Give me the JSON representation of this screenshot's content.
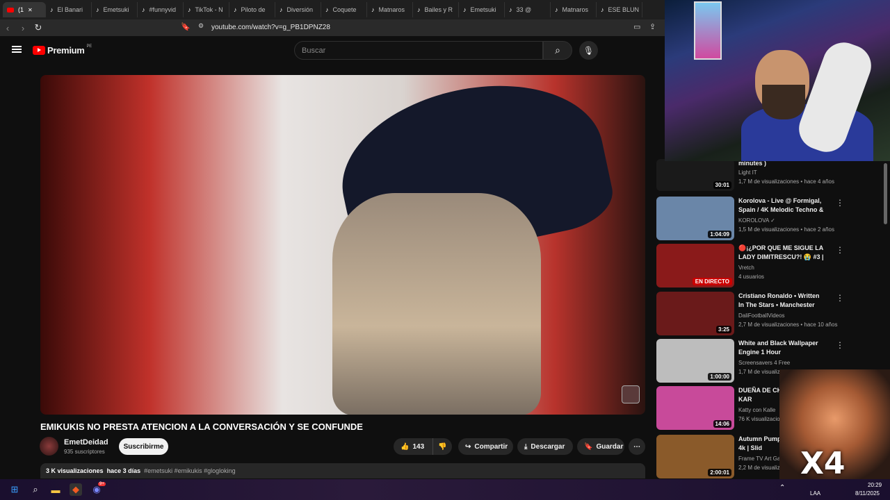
{
  "browser": {
    "tabs": [
      {
        "label": "(1",
        "active": true
      },
      {
        "label": "El Banari"
      },
      {
        "label": "Emetsuki"
      },
      {
        "label": "#funnyvid"
      },
      {
        "label": "TikTok - N"
      },
      {
        "label": "Piloto de"
      },
      {
        "label": "Diversión"
      },
      {
        "label": "Coquete"
      },
      {
        "label": "Matnaros"
      },
      {
        "label": "Bailes y R"
      },
      {
        "label": "Emetsuki"
      },
      {
        "label": "33 @"
      },
      {
        "label": "Matnaros"
      },
      {
        "label": "ESE BLUN"
      }
    ],
    "url": "youtube.com/watch?v=g_PB1DPNZ28"
  },
  "youtube": {
    "logo_text": "Premium",
    "region": "PE",
    "search_placeholder": "Buscar"
  },
  "video": {
    "title": "EMIKUKIS NO PRESTA ATENCION A LA CONVERSACIÓN Y SE CONFUNDE",
    "channel": "EmetDeidad",
    "subscribers": "935 suscriptores",
    "subscribe_label": "Suscribirme",
    "likes": "143",
    "share_label": "Compartir",
    "download_label": "Descargar",
    "save_label": "Guardar",
    "views": "3 K visualizaciones",
    "age": "hace 3 días",
    "tags": "#emetsuki #emikukis #glogloking"
  },
  "recommendations": [
    {
      "title": "minutes )",
      "channel": "Light IT",
      "meta": "1,7 M de visualizaciones • hace 4 años",
      "duration": "30:01",
      "thumb": "#1a1a1a"
    },
    {
      "title": "Korolova - Live @ Formigal, Spain / 4K Melodic Techno & ...",
      "channel": "KOROLOVA ✓",
      "meta": "1,5 M de visualizaciones • hace 2 años",
      "duration": "1:04:09",
      "thumb": "#6a86a8"
    },
    {
      "title": "🔴¡¿POR QUE ME SIGUE LA LADY DIMITRESCU?! 😭 #3 | ...",
      "channel": "Vretch",
      "meta": "4 usuarios",
      "live": "EN DIRECTO",
      "thumb": "#8a1a1a"
    },
    {
      "title": "Cristiano Ronaldo • Written In The Stars • Manchester United...",
      "channel": "DaliFootballVideos",
      "meta": "2,7 M de visualizaciones • hace 10 años",
      "duration": "3:25",
      "thumb": "#6a1a1a"
    },
    {
      "title": "White and Black Wallpaper Engine 1 Hour",
      "channel": "Screensavers 4 Free",
      "meta": "1,7 M de visualiza",
      "duration": "1:00:00",
      "thumb": "#bdbdbd"
    },
    {
      "title": "DUEÑA DE CH LLAVE DE KAR",
      "channel": "Katty con Kalle",
      "meta": "76 K visualizacio",
      "duration": "14:06",
      "thumb": "#c84a9a"
    },
    {
      "title": "Autumn Pumpkin Halloween 4k | Slid",
      "channel": "Frame TV Art Gallery Wa",
      "meta": "2,2 M de visualizaciones",
      "duration": "2:00:01",
      "thumb": "#8a5a2a"
    }
  ],
  "overlay": {
    "meme_text": "X4"
  },
  "taskbar": {
    "time": "20:29",
    "date": "8/11/2025",
    "lang": "LAA",
    "badge": "9+"
  }
}
